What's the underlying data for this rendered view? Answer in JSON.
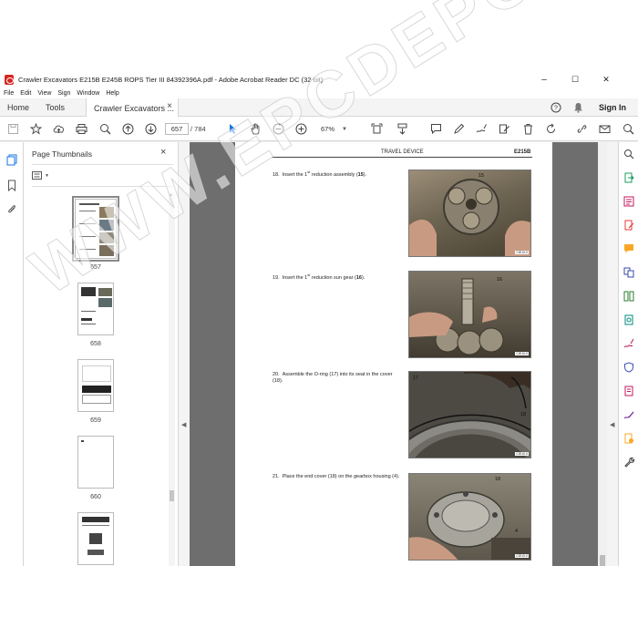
{
  "window": {
    "title": "Crawler Excavators E215B E245B ROPS Tier III 84392396A.pdf - Adobe Acrobat Reader DC (32-bit)",
    "minimize": "–",
    "maximize": "☐",
    "close": "✕"
  },
  "menu": [
    "File",
    "Edit",
    "View",
    "Sign",
    "Window",
    "Help"
  ],
  "tabs": {
    "home": "Home",
    "tools": "Tools",
    "document": "Crawler Excavators ...",
    "close": "×",
    "sign_in": "Sign In"
  },
  "toolbar": {
    "page_current": "657",
    "page_total": "/ 784",
    "zoom": "67%"
  },
  "thumbnails": {
    "title": "Page Thumbnails",
    "close": "×",
    "pages": [
      "657",
      "658",
      "659",
      "660"
    ]
  },
  "document": {
    "header_center": "TRAVEL DEVICE",
    "header_right": "E215B",
    "steps": [
      {
        "num": "18.",
        "pre": "Insert the 1",
        "sup": "st",
        "post": " reduction assembly (",
        "ref": "15",
        "end": ")."
      },
      {
        "num": "19.",
        "pre": "Insert the 1",
        "sup": "st",
        "post": " reduction sun gear (",
        "ref": "16",
        "end": ")."
      },
      {
        "num": "20.",
        "text": "Assemble the O-ring (17) into its seat in the cover (18)."
      },
      {
        "num": "21.",
        "text": "Place the end cover (18) on the gearbox housing (4)."
      }
    ],
    "callouts": [
      "15",
      "16",
      "17",
      "18",
      "18",
      "4"
    ]
  },
  "watermark": "WWW.EPCDEPOT.COM",
  "colors": {
    "acrobat_red": "#d4261f",
    "accent_blue": "#1473e6",
    "doc_background": "#6e6e6e"
  }
}
